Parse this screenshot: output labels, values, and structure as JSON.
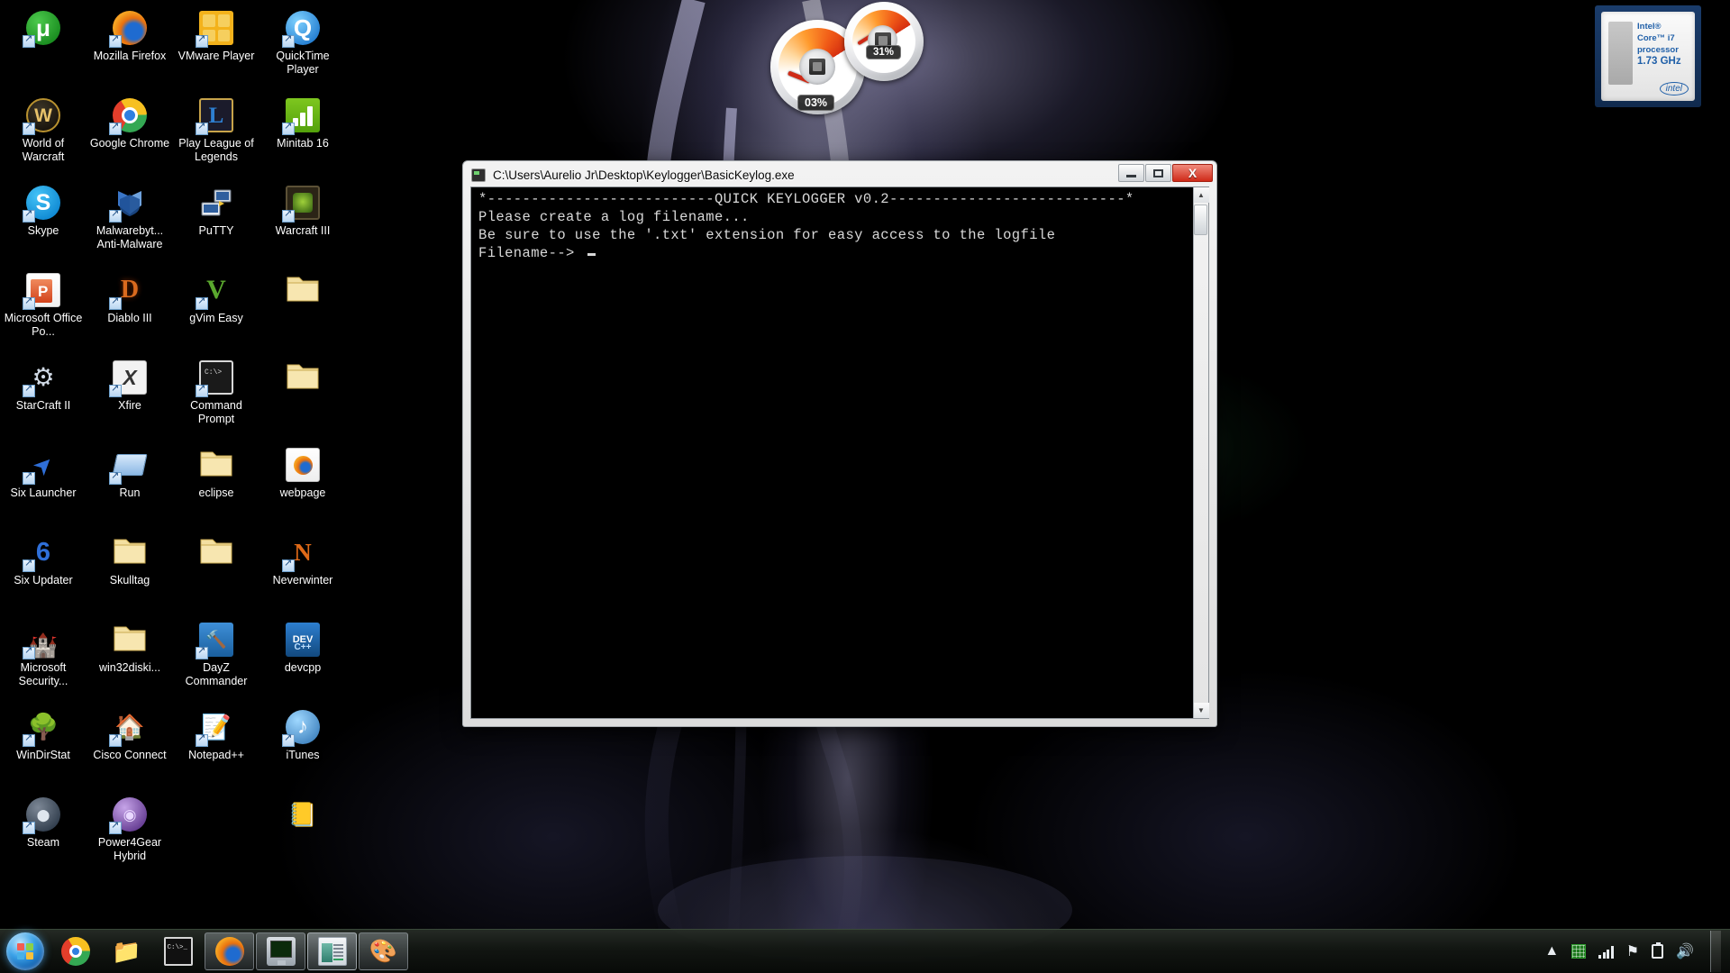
{
  "desktop": {
    "icons": [
      {
        "label": "",
        "icon": "utorrent-icon",
        "art": "ic-utorrent",
        "shortcut": true
      },
      {
        "label": "Mozilla Firefox",
        "icon": "firefox-icon",
        "art": "ic-firefox",
        "shortcut": true
      },
      {
        "label": "VMware Player",
        "icon": "vmware-player-icon",
        "art": "ic-vmware",
        "shortcut": true
      },
      {
        "label": "QuickTime Player",
        "icon": "quicktime-player-icon",
        "art": "ic-quicktime",
        "shortcut": true
      },
      {
        "label": "World of Warcraft",
        "icon": "world-of-warcraft-icon",
        "art": "ic-wow",
        "shortcut": true
      },
      {
        "label": "Google Chrome",
        "icon": "google-chrome-icon",
        "art": "ic-chrome",
        "shortcut": true
      },
      {
        "label": "Play League of Legends",
        "icon": "league-of-legends-icon",
        "art": "ic-lol",
        "shortcut": true
      },
      {
        "label": "Minitab 16",
        "icon": "minitab-icon",
        "art": "ic-minitab",
        "shortcut": true
      },
      {
        "label": "Skype",
        "icon": "skype-icon",
        "art": "ic-skype",
        "shortcut": true
      },
      {
        "label": "Malwarebyt... Anti-Malware",
        "icon": "malwarebytes-icon",
        "art": "ic-mbam",
        "shortcut": true
      },
      {
        "label": "PuTTY",
        "icon": "putty-icon",
        "art": "ic-putty",
        "shortcut": false
      },
      {
        "label": "Warcraft III",
        "icon": "warcraft-iii-icon",
        "art": "ic-wc3",
        "shortcut": true
      },
      {
        "label": "Microsoft Office Po...",
        "icon": "powerpoint-icon",
        "art": "ic-ppt",
        "shortcut": true
      },
      {
        "label": "Diablo III",
        "icon": "diablo-iii-icon",
        "art": "ic-d3",
        "shortcut": true
      },
      {
        "label": "gVim Easy",
        "icon": "gvim-icon",
        "art": "ic-gvim",
        "shortcut": true
      },
      {
        "label": "",
        "icon": "folder-icon",
        "art": "ic-folder",
        "shortcut": false
      },
      {
        "label": "StarCraft II",
        "icon": "starcraft-ii-icon",
        "art": "ic-sc2",
        "shortcut": true
      },
      {
        "label": "Xfire",
        "icon": "xfire-icon",
        "art": "ic-xfire",
        "shortcut": true
      },
      {
        "label": "Command Prompt",
        "icon": "command-prompt-icon",
        "art": "ic-cmd",
        "shortcut": true
      },
      {
        "label": "",
        "icon": "folder-icon",
        "art": "ic-folder",
        "shortcut": false
      },
      {
        "label": "Six Launcher",
        "icon": "six-launcher-icon",
        "art": "ic-six",
        "shortcut": true
      },
      {
        "label": "Run",
        "icon": "run-icon",
        "art": "ic-run",
        "shortcut": true
      },
      {
        "label": "eclipse",
        "icon": "folder-icon",
        "art": "ic-folder",
        "shortcut": false
      },
      {
        "label": "webpage",
        "icon": "webpage-icon",
        "art": "ic-webpage",
        "shortcut": false
      },
      {
        "label": "Six Updater",
        "icon": "six-updater-icon",
        "art": "ic-six6",
        "shortcut": true
      },
      {
        "label": "Skulltag",
        "icon": "folder-icon",
        "art": "ic-folder",
        "shortcut": false
      },
      {
        "label": "",
        "icon": "folder-icon",
        "art": "ic-folder",
        "shortcut": false
      },
      {
        "label": "Neverwinter",
        "icon": "neverwinter-icon",
        "art": "ic-never",
        "shortcut": true
      },
      {
        "label": "Microsoft Security...",
        "icon": "microsoft-security-essentials-icon",
        "art": "ic-mse",
        "shortcut": true
      },
      {
        "label": "win32diski...",
        "icon": "folder-icon",
        "art": "ic-folder",
        "shortcut": false
      },
      {
        "label": "DayZ Commander",
        "icon": "dayz-commander-icon",
        "art": "ic-dayz",
        "shortcut": true
      },
      {
        "label": "devcpp",
        "icon": "devcpp-icon",
        "art": "ic-devcpp",
        "shortcut": false
      },
      {
        "label": "WinDirStat",
        "icon": "windirstat-icon",
        "art": "ic-windirstat",
        "shortcut": true
      },
      {
        "label": "Cisco Connect",
        "icon": "cisco-connect-icon",
        "art": "ic-cisco",
        "shortcut": true
      },
      {
        "label": "Notepad++",
        "icon": "notepad-plus-plus-icon",
        "art": "ic-npp",
        "shortcut": true
      },
      {
        "label": "iTunes",
        "icon": "itunes-icon",
        "art": "ic-itunes",
        "shortcut": true
      },
      {
        "label": "Steam",
        "icon": "steam-icon",
        "art": "ic-steam",
        "shortcut": true
      },
      {
        "label": "Power4Gear Hybrid",
        "icon": "power4gear-hybrid-icon",
        "art": "ic-p4g",
        "shortcut": true
      },
      {
        "label": "",
        "icon": "recycle-bin-icon",
        "art": "ic-trash",
        "shortcut": false
      },
      {
        "label": "",
        "icon": "book-icon",
        "art": "ic-book",
        "shortcut": false
      }
    ]
  },
  "gadgets": {
    "cpu_meter": {
      "name": "cpu-meter",
      "value": "03%"
    },
    "memory_meter": {
      "name": "memory-meter",
      "value": "31%"
    },
    "cpu_sticker": {
      "line1": "Intel®",
      "line2": "Core™ i7",
      "line3": "processor",
      "line4": "1.73 GHz",
      "logo": "intel"
    }
  },
  "console_window": {
    "title": "C:\\Users\\Aurelio Jr\\Desktop\\Keylogger\\BasicKeylog.exe",
    "minimize_label": "Minimize",
    "maximize_label": "Maximize",
    "close_label": "X",
    "output": "*--------------------------QUICK KEYLOGGER v0.2---------------------------*\nPlease create a log filename...\nBe sure to use the '.txt' extension for easy access to the logfile\nFilename--> ",
    "scroll_up": "▲",
    "scroll_down": "▼"
  },
  "taskbar": {
    "start_label": "Start",
    "pinned": [
      {
        "name": "taskbar-chrome",
        "art": "tbi-chrome",
        "state": "pinned"
      },
      {
        "name": "taskbar-windows-explorer",
        "art": "tbi-explorer",
        "state": "pinned"
      },
      {
        "name": "taskbar-command-prompt",
        "art": "tbi-cmd",
        "state": "pinned"
      }
    ],
    "running": [
      {
        "name": "taskbar-firefox",
        "art": "tbi-firefox",
        "state": "running"
      },
      {
        "name": "taskbar-monitor-app",
        "art": "tbi-monitor",
        "state": "running"
      },
      {
        "name": "taskbar-notepad-window",
        "art": "tbi-notepadwin",
        "state": "active"
      },
      {
        "name": "taskbar-paint",
        "art": "tbi-paint",
        "state": "running"
      }
    ],
    "tray": {
      "show_hidden": "▲",
      "icons": [
        {
          "name": "network-activity-icon"
        },
        {
          "name": "wireless-signal-icon"
        },
        {
          "name": "action-center-flag-icon"
        },
        {
          "name": "battery-charging-icon"
        },
        {
          "name": "volume-icon"
        }
      ]
    }
  }
}
